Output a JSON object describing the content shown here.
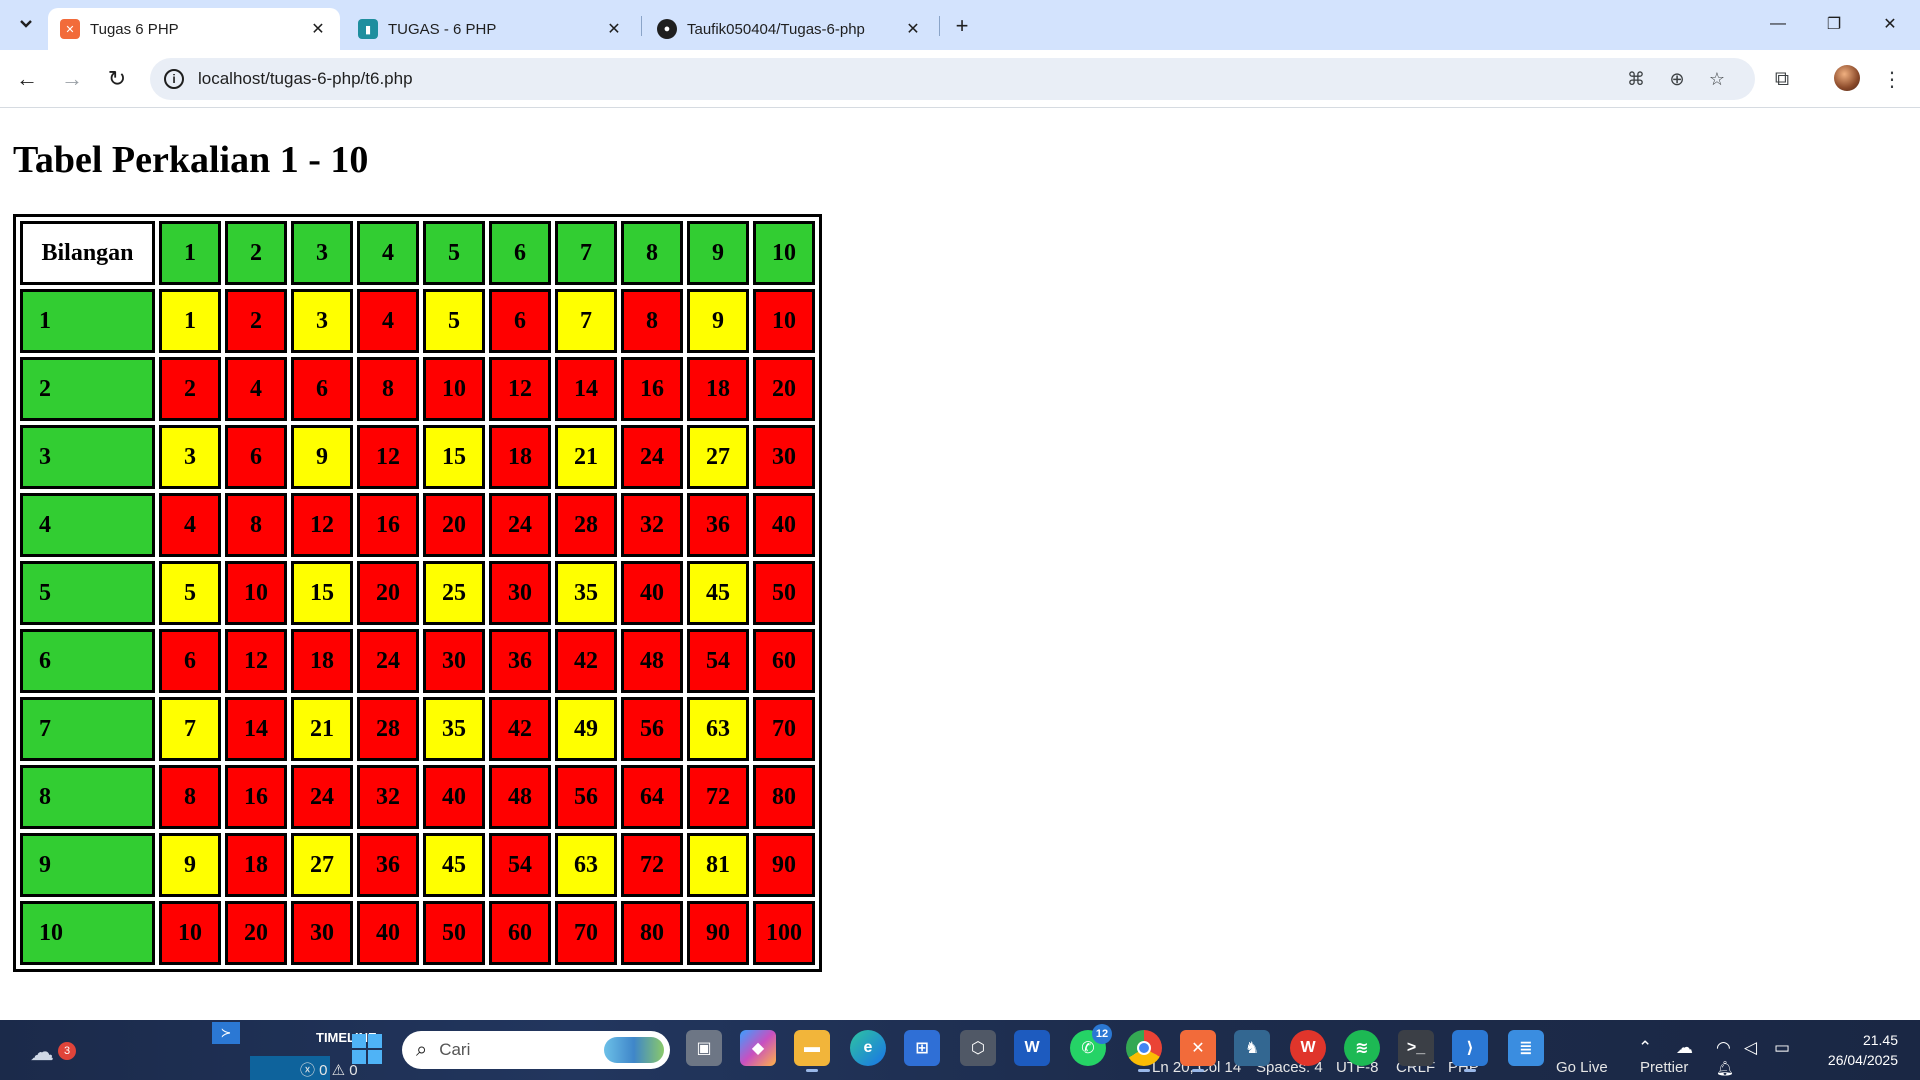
{
  "browser": {
    "tabs": [
      {
        "title": "Tugas 6 PHP",
        "active": true,
        "favicon": "xampp-icon"
      },
      {
        "title": "TUGAS - 6 PHP",
        "active": false,
        "favicon": "classroom-icon"
      },
      {
        "title": "Taufik050404/Tugas-6-php",
        "active": false,
        "favicon": "github-icon"
      }
    ],
    "url": "localhost/tugas-6-php/t6.php"
  },
  "page": {
    "heading": "Tabel Perkalian 1 - 10",
    "table": {
      "corner_label": "Bilangan",
      "header": [
        "1",
        "2",
        "3",
        "4",
        "5",
        "6",
        "7",
        "8",
        "9",
        "10"
      ],
      "rows": [
        {
          "label": "1",
          "cells": [
            "1",
            "2",
            "3",
            "4",
            "5",
            "6",
            "7",
            "8",
            "9",
            "10"
          ]
        },
        {
          "label": "2",
          "cells": [
            "2",
            "4",
            "6",
            "8",
            "10",
            "12",
            "14",
            "16",
            "18",
            "20"
          ]
        },
        {
          "label": "3",
          "cells": [
            "3",
            "6",
            "9",
            "12",
            "15",
            "18",
            "21",
            "24",
            "27",
            "30"
          ]
        },
        {
          "label": "4",
          "cells": [
            "4",
            "8",
            "12",
            "16",
            "20",
            "24",
            "28",
            "32",
            "36",
            "40"
          ]
        },
        {
          "label": "5",
          "cells": [
            "5",
            "10",
            "15",
            "20",
            "25",
            "30",
            "35",
            "40",
            "45",
            "50"
          ]
        },
        {
          "label": "6",
          "cells": [
            "6",
            "12",
            "18",
            "24",
            "30",
            "36",
            "42",
            "48",
            "54",
            "60"
          ]
        },
        {
          "label": "7",
          "cells": [
            "7",
            "14",
            "21",
            "28",
            "35",
            "42",
            "49",
            "56",
            "63",
            "70"
          ]
        },
        {
          "label": "8",
          "cells": [
            "8",
            "16",
            "24",
            "32",
            "40",
            "48",
            "56",
            "64",
            "72",
            "80"
          ]
        },
        {
          "label": "9",
          "cells": [
            "9",
            "18",
            "27",
            "36",
            "45",
            "54",
            "63",
            "72",
            "81",
            "90"
          ]
        },
        {
          "label": "10",
          "cells": [
            "10",
            "20",
            "30",
            "40",
            "50",
            "60",
            "70",
            "80",
            "90",
            "100"
          ]
        }
      ],
      "colors": {
        "corner": "#ffffff",
        "header": "#32cd32",
        "odd": "#ffff00",
        "even": "#ff0000"
      }
    }
  },
  "taskbar": {
    "widget_badge": "3",
    "timeline_label": "TIMELINE",
    "search_placeholder": "Cari",
    "whatsapp_badge": "12",
    "status": {
      "problems": "ⓧ 0 ⚠ 0",
      "cursor": "Ln 20, Col 14",
      "spaces": "Spaces: 4",
      "encoding": "UTF-8",
      "eol": "CRLF",
      "language": "PHP",
      "go_live": "Go Live",
      "prettier": "Prettier"
    },
    "clock": {
      "time": "21.45",
      "date": "26/04/2025"
    }
  }
}
